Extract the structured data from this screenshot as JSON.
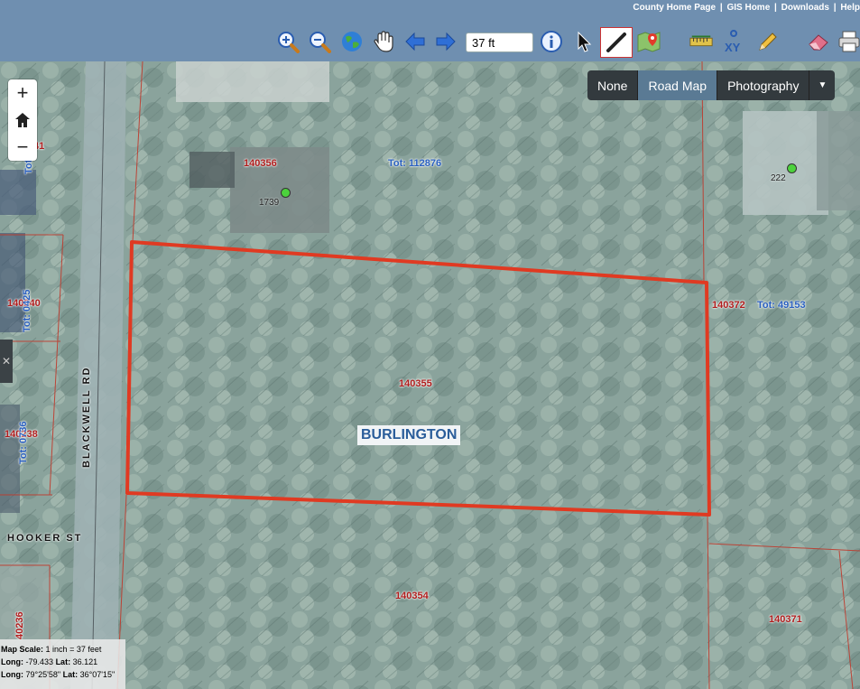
{
  "header": {
    "links": [
      "County Home Page",
      "GIS Home",
      "Downloads",
      "Help"
    ],
    "scale_value": "37 ft"
  },
  "toolbar": {
    "tools": [
      "zoom-in-icon",
      "zoom-out-icon",
      "globe-icon",
      "pan-hand-icon",
      "back-arrow-icon",
      "forward-arrow-icon",
      "info-icon",
      "select-pointer-icon",
      "draw-line-icon",
      "map-pin-icon",
      "measure-ruler-icon",
      "xy-coordinates-icon",
      "pencil-icon",
      "eraser-icon",
      "print-icon"
    ],
    "xy_label": "XY"
  },
  "map_controls": {
    "zoom_in": "+",
    "home": "⌂",
    "zoom_out": "−"
  },
  "basemap": {
    "options": [
      "None",
      "Road Map",
      "Photography"
    ],
    "active": "Road Map"
  },
  "map": {
    "city_label": "BURLINGTON",
    "parcels": {
      "p140356": "140356",
      "p140355": "140355",
      "p140372": "140372",
      "p140354": "140354",
      "p140371": "140371",
      "p140240": "140240",
      "p140238": "140238",
      "p40236": "40236",
      "p41": "41"
    },
    "totals": {
      "t112876": "Tot: 112876",
      "t49153": "Tot: 49153",
      "t425": "Tot: 0425",
      "t736": "Tot: 0736",
      "t_top": "Tot"
    },
    "addresses": {
      "a1739": "1739",
      "a222": "222"
    },
    "streets": {
      "blackwell": "BLACKWELL RD",
      "hooker": "HOOKER ST"
    }
  },
  "readout": {
    "scale_label": "Map Scale:",
    "scale_value": "1 inch = 37 feet",
    "long_label": "Long:",
    "long_value": "-79.433",
    "lat_label": "Lat:",
    "lat_value": "36.121",
    "long_dms_label": "Long:",
    "long_dms": "79°25'58\"",
    "lat_dms_label": "Lat:",
    "lat_dms": "36°07'15\""
  },
  "colors": {
    "header": "#6f8fb0",
    "selection": "#e03a22",
    "parcel_label": "#b01c1c",
    "tot_label": "#2a60c0"
  }
}
